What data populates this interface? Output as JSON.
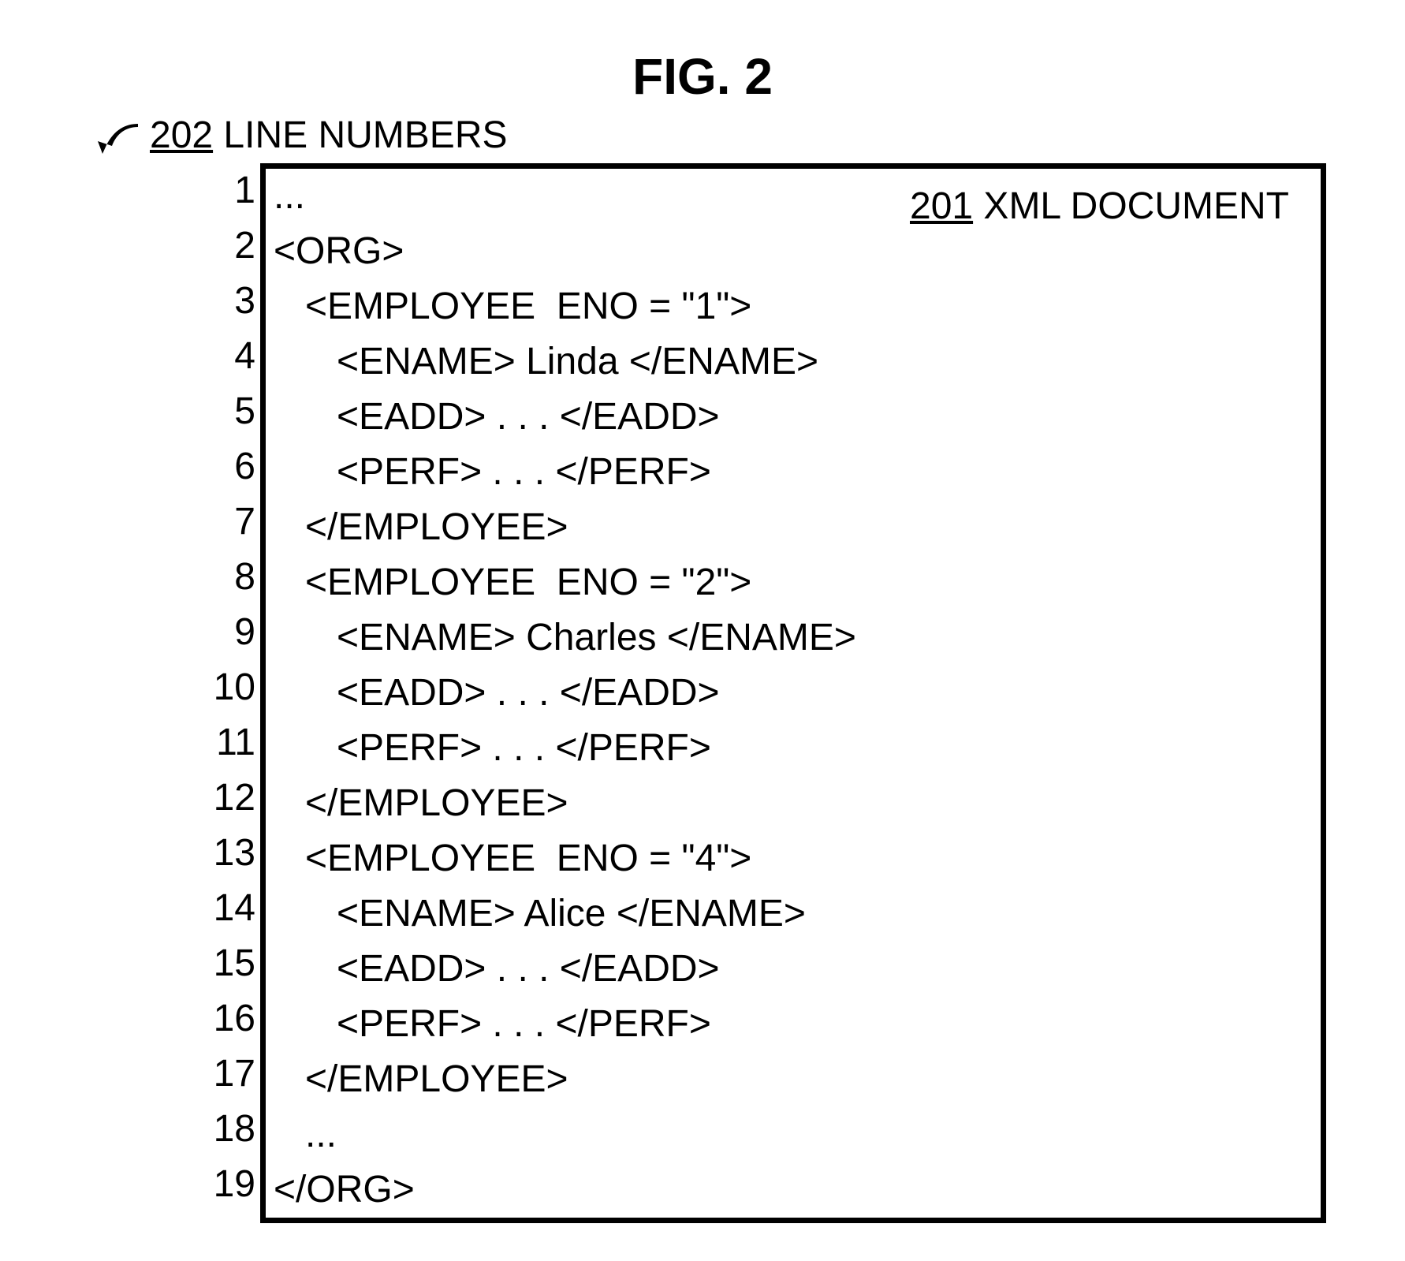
{
  "figure": {
    "title": "FIG. 2",
    "line_numbers_ref": "202",
    "line_numbers_label": " LINE NUMBERS",
    "box_ref": "201",
    "box_label": " XML DOCUMENT"
  },
  "code": {
    "lines": [
      {
        "n": "1",
        "text": "..."
      },
      {
        "n": "2",
        "text": "<ORG>"
      },
      {
        "n": "3",
        "text": "   <EMPLOYEE  ENO = \"1\">"
      },
      {
        "n": "4",
        "text": "      <ENAME> Linda </ENAME>"
      },
      {
        "n": "5",
        "text": "      <EADD> . . . </EADD>"
      },
      {
        "n": "6",
        "text": "      <PERF> . . . </PERF>"
      },
      {
        "n": "7",
        "text": "   </EMPLOYEE>"
      },
      {
        "n": "8",
        "text": "   <EMPLOYEE  ENO = \"2\">"
      },
      {
        "n": "9",
        "text": "      <ENAME> Charles </ENAME>"
      },
      {
        "n": "10",
        "text": "      <EADD> . . . </EADD>"
      },
      {
        "n": "11",
        "text": "      <PERF> . . . </PERF>"
      },
      {
        "n": "12",
        "text": "   </EMPLOYEE>"
      },
      {
        "n": "13",
        "text": "   <EMPLOYEE  ENO = \"4\">"
      },
      {
        "n": "14",
        "text": "      <ENAME> Alice </ENAME>"
      },
      {
        "n": "15",
        "text": "      <EADD> . . . </EADD>"
      },
      {
        "n": "16",
        "text": "      <PERF> . . . </PERF>"
      },
      {
        "n": "17",
        "text": "   </EMPLOYEE>"
      },
      {
        "n": "18",
        "text": "   ..."
      },
      {
        "n": "19",
        "text": "</ORG>"
      }
    ]
  }
}
